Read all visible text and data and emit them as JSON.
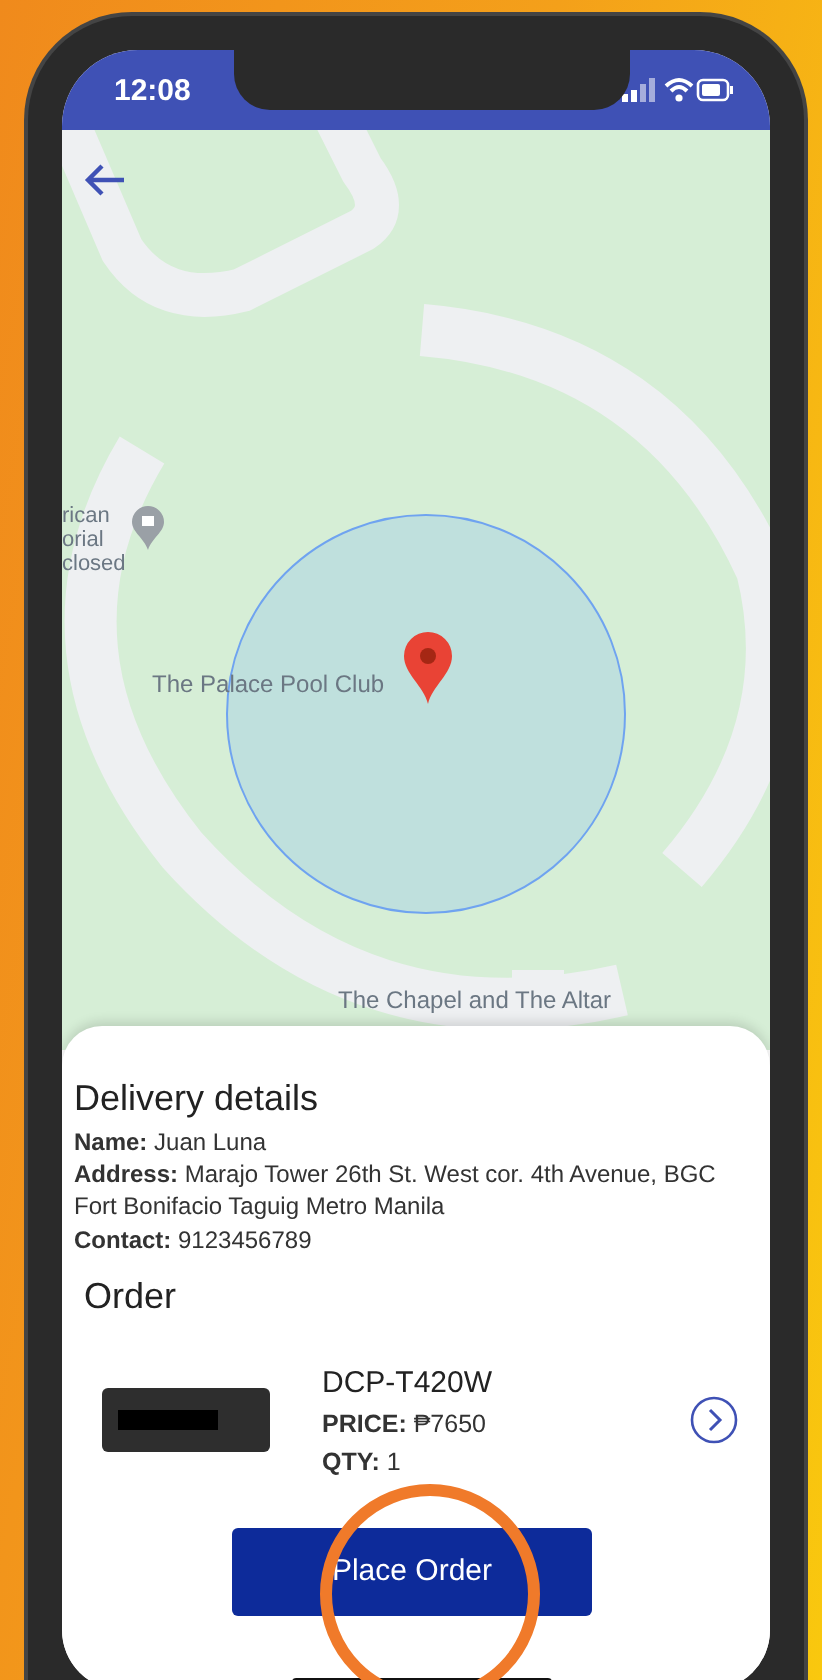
{
  "status_bar": {
    "time": "12:08"
  },
  "map": {
    "labels": [
      {
        "kind": "poi",
        "lines": [
          "rican",
          "orial",
          "closed"
        ]
      },
      {
        "kind": "place",
        "lines": [
          "The Palace Pool Club"
        ]
      },
      {
        "kind": "place",
        "lines": [
          "The Chapel and The Altar"
        ]
      }
    ]
  },
  "delivery": {
    "title": "Delivery details",
    "fields": [
      "**Name:** Juan Luna",
      "**Address:** Marajo Tower 26th St. West cor. 4th Avenue, BGC Fort Bonifacio Taguig Metro Manila",
      "**Contact:** 9123456789"
    ]
  },
  "order": {
    "title": "Order",
    "items": [
      {
        "name": "DCP-T420W",
        "price": "**PRICE:** ₱7650",
        "qty": "**QTY:** 1"
      }
    ]
  },
  "button": "Place Order"
}
